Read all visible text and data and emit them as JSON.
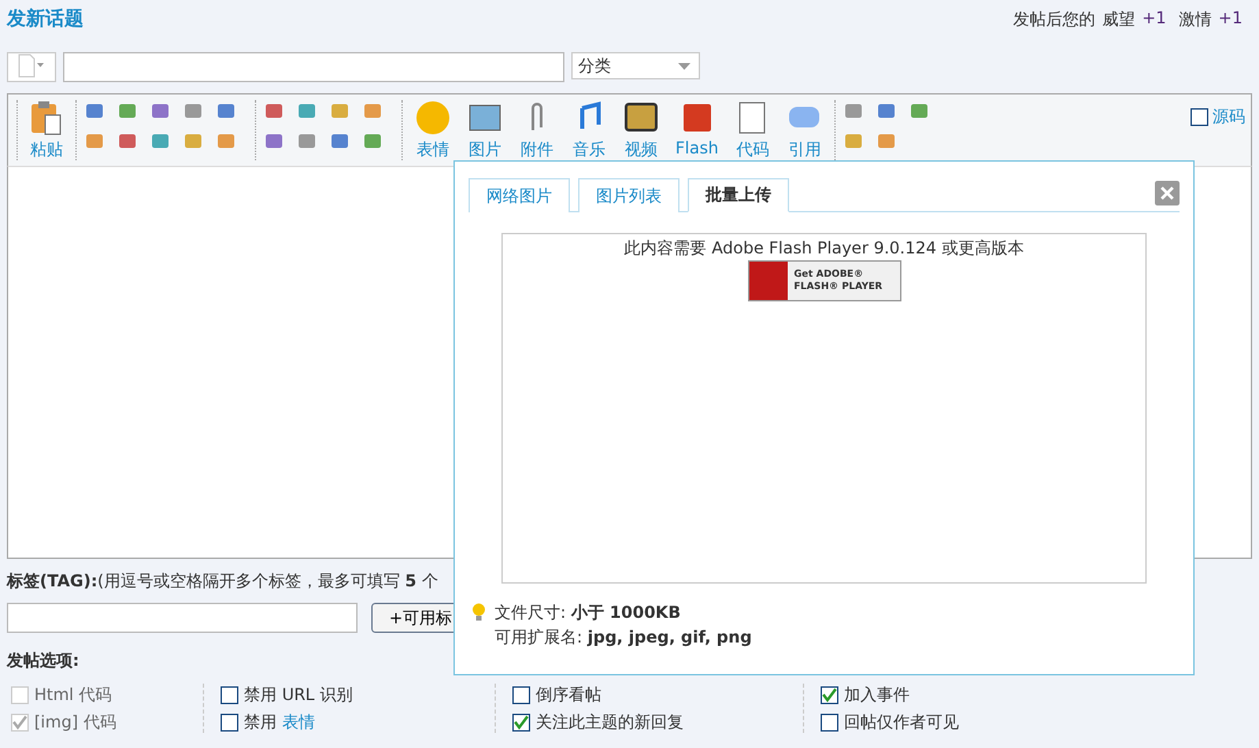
{
  "page": {
    "title": "发新话题",
    "credit_prefix": "发帖后您的",
    "credits": [
      {
        "name": "威望",
        "value": "+1"
      },
      {
        "name": "激情",
        "value": "+1"
      }
    ]
  },
  "subject_row": {
    "category_select": "分类"
  },
  "toolbar": {
    "buttons": [
      {
        "label": "表情"
      },
      {
        "label": "图片"
      },
      {
        "label": "附件"
      },
      {
        "label": "音乐"
      },
      {
        "label": "视频"
      },
      {
        "label": "Flash"
      },
      {
        "label": "代码"
      },
      {
        "label": "引用"
      }
    ],
    "paste_label": "粘贴",
    "source_toggle": {
      "label": "源码",
      "checked": false
    }
  },
  "popup": {
    "tabs": [
      {
        "label": "网络图片",
        "selected": false
      },
      {
        "label": "图片列表",
        "selected": false
      },
      {
        "label": "批量上传",
        "selected": true
      }
    ],
    "flash_message": "此内容需要 Adobe Flash Player 9.0.124 或更高版本",
    "flash_badge": {
      "line_1": "Get ADOBE®",
      "line_2": "FLASH® PLAYER"
    },
    "info": [
      "文件尺寸: **小于  1000KB**",
      "可用扩展名: **jpg, jpeg, gif, png**"
    ]
  },
  "tags": {
    "label": "标签(TAG):",
    "hint": "(用逗号或空格隔开多个标签，最多可填写 **5** 个",
    "button": "+可用标"
  },
  "options": {
    "title": "发帖选项:",
    "columns": [
      [
        {
          "label": "Html 代码",
          "checked": false,
          "disabled": true
        },
        {
          "label": "[img] 代码",
          "checked": true,
          "disabled": true
        }
      ],
      [
        {
          "label": "禁用  URL 识别",
          "checked": false,
          "disabled": false
        },
        {
          "label": "禁用",
          "link": "表情",
          "checked": false,
          "disabled": false
        }
      ],
      [
        {
          "label": "倒序看帖",
          "checked": false,
          "disabled": false
        },
        {
          "label": "关注此主题的新回复",
          "checked": true,
          "disabled": false
        }
      ],
      [
        {
          "label": "加入事件",
          "checked": true,
          "disabled": false
        },
        {
          "label": "回帖仅作者可见",
          "checked": false,
          "disabled": false
        }
      ]
    ]
  }
}
